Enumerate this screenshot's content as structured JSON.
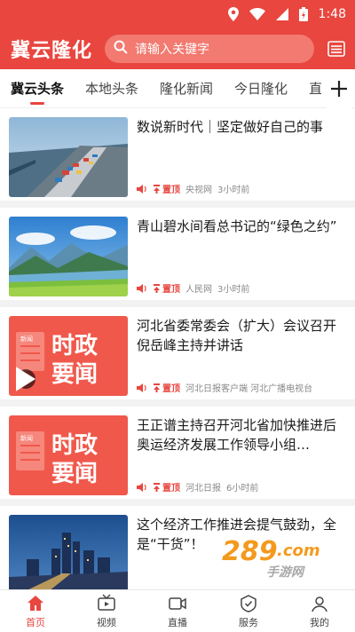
{
  "status_bar": {
    "time": "1:48"
  },
  "header": {
    "app_title": "冀云隆化",
    "search_placeholder": "请输入关键字"
  },
  "tabs": [
    {
      "label": "冀云头条",
      "active": true
    },
    {
      "label": "本地头条",
      "active": false
    },
    {
      "label": "隆化新闻",
      "active": false
    },
    {
      "label": "今日隆化",
      "active": false
    },
    {
      "label": "直",
      "active": false
    }
  ],
  "news": [
    {
      "title": "数说新时代｜坚定做好自己的事",
      "pin": "置顶",
      "source": "央视网",
      "time": "3小时前",
      "thumb": "port-icon"
    },
    {
      "title": "青山碧水间看总书记的“绿色之约”",
      "pin": "置顶",
      "source": "人民网",
      "time": "3小时前",
      "thumb": "landscape-icon"
    },
    {
      "title": "河北省委常委会（扩大）会议召开 倪岳峰主持并讲话",
      "pin": "置顶",
      "source": "河北日报客户端 河北广播电视台",
      "time": "",
      "thumb": "news-poster"
    },
    {
      "title": "王正谱主持召开河北省加快推进后奥运经济发展工作领导小组…",
      "pin": "置顶",
      "source": "河北日报",
      "time": "6小时前",
      "thumb": "news-poster"
    },
    {
      "title": "这个经济工作推进会提气鼓劲，全是“干货”！",
      "pin": "",
      "source": "",
      "time": "",
      "thumb": "city-night-icon"
    }
  ],
  "poster": {
    "small": "新闻",
    "line1": "时政",
    "line2": "要闻"
  },
  "bottom_nav": [
    {
      "label": "首页",
      "icon": "home-icon",
      "active": true
    },
    {
      "label": "视频",
      "icon": "tv-icon",
      "active": false
    },
    {
      "label": "直播",
      "icon": "live-icon",
      "active": false
    },
    {
      "label": "服务",
      "icon": "service-icon",
      "active": false
    },
    {
      "label": "我的",
      "icon": "profile-icon",
      "active": false
    }
  ],
  "watermark": {
    "number": "289",
    "domain": ".com",
    "text": "手游网"
  },
  "colors": {
    "brand": "#e8463f",
    "poster_bg": "#f0584c"
  }
}
